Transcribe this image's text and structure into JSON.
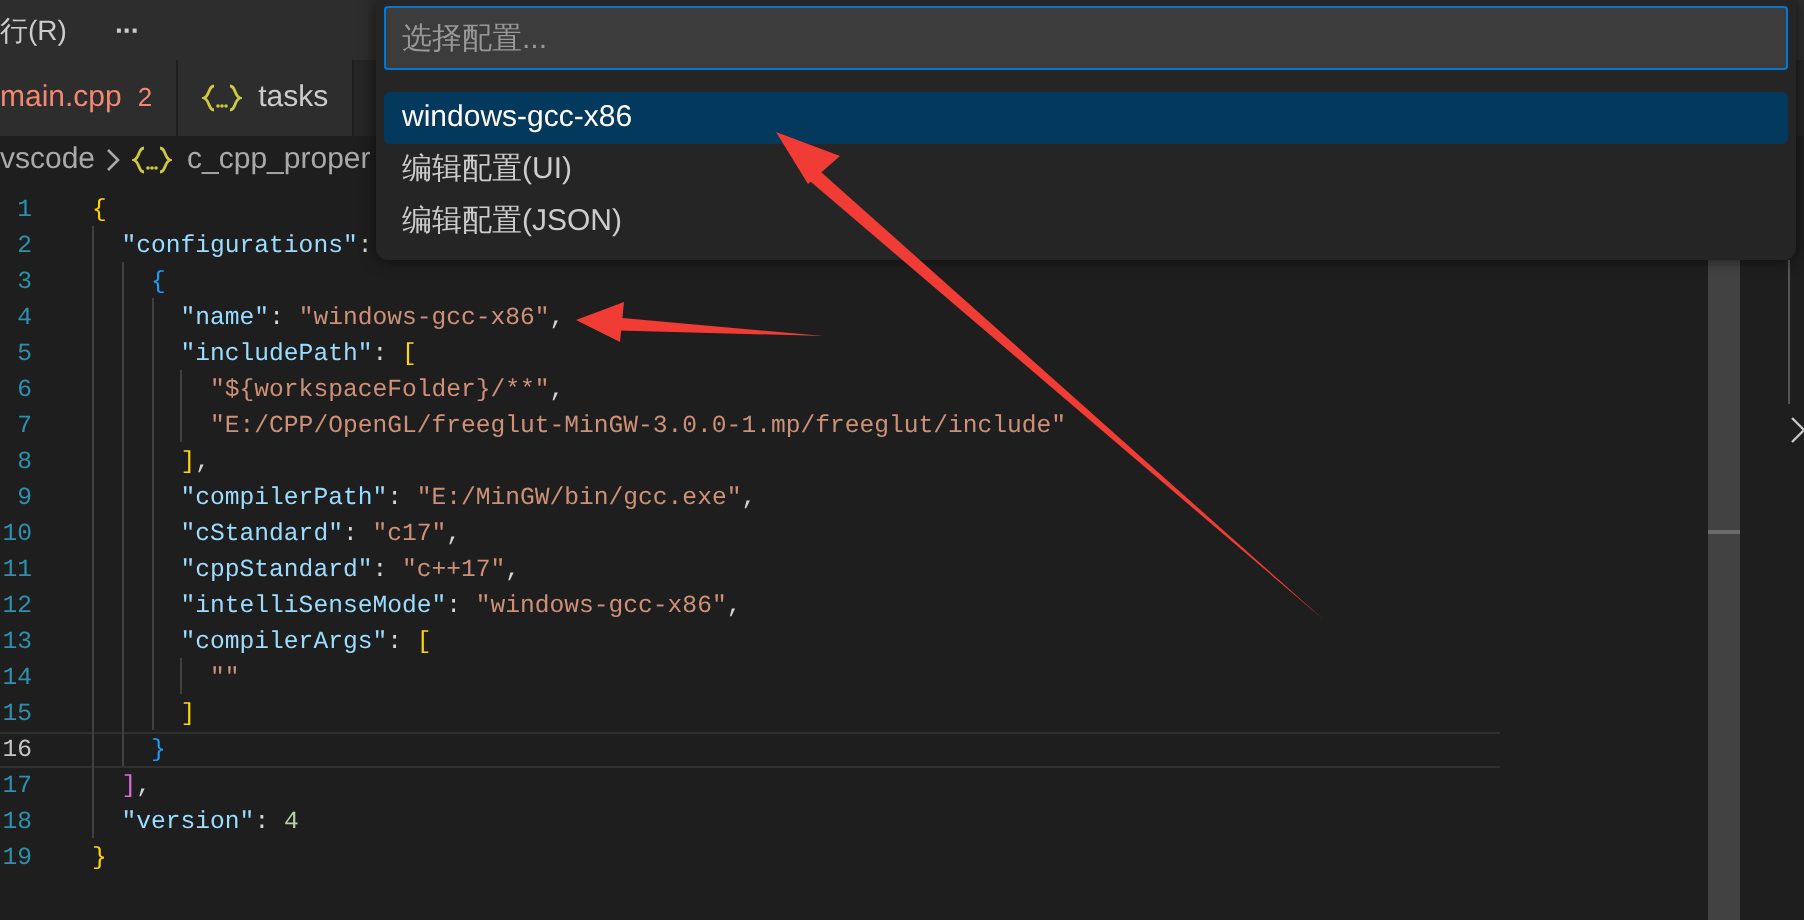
{
  "menu_bar": {
    "items": [
      {
        "kind": "text",
        "label": "行(R)"
      },
      {
        "kind": "more",
        "label": "···"
      }
    ]
  },
  "tabs": [
    {
      "label": "main.cpp",
      "badge": "2",
      "selected": false,
      "has_errors": true
    },
    {
      "label": "tasks",
      "selected": false,
      "has_errors": false
    }
  ],
  "breadcrumb": {
    "folder": "vscode",
    "file": "c_cpp_proper"
  },
  "editor": {
    "lines": [
      {
        "number": "1",
        "current": false,
        "tokens": [
          {
            "kind": "b1",
            "text": "{"
          }
        ]
      },
      {
        "number": "2",
        "current": false,
        "tokens": [
          {
            "kind": "key",
            "text": "  \"configurations\""
          },
          {
            "kind": "punct",
            "text": ":"
          }
        ]
      },
      {
        "number": "3",
        "current": false,
        "tokens": [
          {
            "kind": "b3",
            "text": "    {"
          }
        ]
      },
      {
        "number": "4",
        "current": false,
        "tokens": [
          {
            "kind": "key",
            "text": "      \"name\""
          },
          {
            "kind": "punct",
            "text": ": "
          },
          {
            "kind": "string",
            "text": "\"windows-gcc-x86\""
          },
          {
            "kind": "punct",
            "text": ","
          }
        ]
      },
      {
        "number": "5",
        "current": false,
        "tokens": [
          {
            "kind": "key",
            "text": "      \"includePath\""
          },
          {
            "kind": "punct",
            "text": ": "
          },
          {
            "kind": "b1",
            "text": "["
          }
        ]
      },
      {
        "number": "6",
        "current": false,
        "tokens": [
          {
            "kind": "string",
            "text": "        \"${workspaceFolder}/**\""
          },
          {
            "kind": "punct",
            "text": ","
          }
        ]
      },
      {
        "number": "7",
        "current": false,
        "tokens": [
          {
            "kind": "string",
            "text": "        \"E:/CPP/OpenGL/freeglut-MinGW-3.0.0-1.mp/freeglut/include\""
          }
        ]
      },
      {
        "number": "8",
        "current": false,
        "tokens": [
          {
            "kind": "b1",
            "text": "      ]"
          },
          {
            "kind": "punct",
            "text": ","
          }
        ]
      },
      {
        "number": "9",
        "current": false,
        "tokens": [
          {
            "kind": "key",
            "text": "      \"compilerPath\""
          },
          {
            "kind": "punct",
            "text": ": "
          },
          {
            "kind": "string",
            "text": "\"E:/MinGW/bin/gcc.exe\""
          },
          {
            "kind": "punct",
            "text": ","
          }
        ]
      },
      {
        "number": "10",
        "current": false,
        "tokens": [
          {
            "kind": "key",
            "text": "      \"cStandard\""
          },
          {
            "kind": "punct",
            "text": ": "
          },
          {
            "kind": "string",
            "text": "\"c17\""
          },
          {
            "kind": "punct",
            "text": ","
          }
        ]
      },
      {
        "number": "11",
        "current": false,
        "tokens": [
          {
            "kind": "key",
            "text": "      \"cppStandard\""
          },
          {
            "kind": "punct",
            "text": ": "
          },
          {
            "kind": "string",
            "text": "\"c++17\""
          },
          {
            "kind": "punct",
            "text": ","
          }
        ]
      },
      {
        "number": "12",
        "current": false,
        "tokens": [
          {
            "kind": "key",
            "text": "      \"intelliSenseMode\""
          },
          {
            "kind": "punct",
            "text": ": "
          },
          {
            "kind": "string",
            "text": "\"windows-gcc-x86\""
          },
          {
            "kind": "punct",
            "text": ","
          }
        ]
      },
      {
        "number": "13",
        "current": false,
        "tokens": [
          {
            "kind": "key",
            "text": "      \"compilerArgs\""
          },
          {
            "kind": "punct",
            "text": ": "
          },
          {
            "kind": "b1",
            "text": "["
          }
        ]
      },
      {
        "number": "14",
        "current": false,
        "tokens": [
          {
            "kind": "string",
            "text": "        \"\""
          }
        ]
      },
      {
        "number": "15",
        "current": false,
        "tokens": [
          {
            "kind": "b1",
            "text": "      ]"
          }
        ]
      },
      {
        "number": "16",
        "current": true,
        "tokens": [
          {
            "kind": "b3",
            "text": "    }"
          }
        ]
      },
      {
        "number": "17",
        "current": false,
        "tokens": [
          {
            "kind": "b2",
            "text": "  ]"
          },
          {
            "kind": "punct",
            "text": ","
          }
        ]
      },
      {
        "number": "18",
        "current": false,
        "tokens": [
          {
            "kind": "key",
            "text": "  \"version\""
          },
          {
            "kind": "punct",
            "text": ": "
          },
          {
            "kind": "number",
            "text": "4"
          }
        ]
      },
      {
        "number": "19",
        "current": false,
        "tokens": [
          {
            "kind": "b1",
            "text": "}"
          }
        ]
      }
    ]
  },
  "quick_pick": {
    "placeholder": "选择配置...",
    "items": [
      {
        "label": "windows-gcc-x86",
        "selected": true
      },
      {
        "label": "编辑配置(UI)",
        "selected": false
      },
      {
        "label": "编辑配置(JSON)",
        "selected": false
      }
    ]
  }
}
